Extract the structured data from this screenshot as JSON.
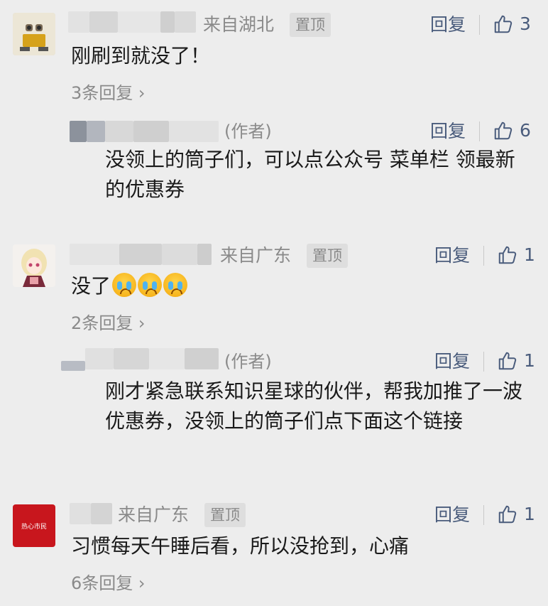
{
  "comments": [
    {
      "location": "来自湖北",
      "pin_label": "置顶",
      "reply_label": "回复",
      "likes": "3",
      "text": "刚刷到就没了！",
      "more_replies": "3条回复",
      "author_reply": {
        "author_tag": "(作者)",
        "reply_label": "回复",
        "likes": "6",
        "text": "没领上的筒子们，可以点公众号 菜单栏 领最新的优惠券"
      }
    },
    {
      "location": "来自广东",
      "pin_label": "置顶",
      "reply_label": "回复",
      "likes": "1",
      "text": "没了",
      "more_replies": "2条回复",
      "author_reply": {
        "author_tag": "(作者)",
        "reply_label": "回复",
        "likes": "1",
        "text": "刚才紧急联系知识星球的伙伴，帮我加推了一波优惠券，没领上的筒子们点下面这个链接"
      }
    },
    {
      "location": "来自广东",
      "pin_label": "置顶",
      "reply_label": "回复",
      "likes": "1",
      "text": "习惯每天午睡后看，所以没抢到，心痛",
      "more_replies": "6条回复",
      "avatar_text": "热心市民"
    }
  ],
  "colors": {
    "background": "#ededed",
    "link": "#4a5c7c",
    "meta": "#8a8a8a",
    "avatar_red": "#c8161d"
  }
}
